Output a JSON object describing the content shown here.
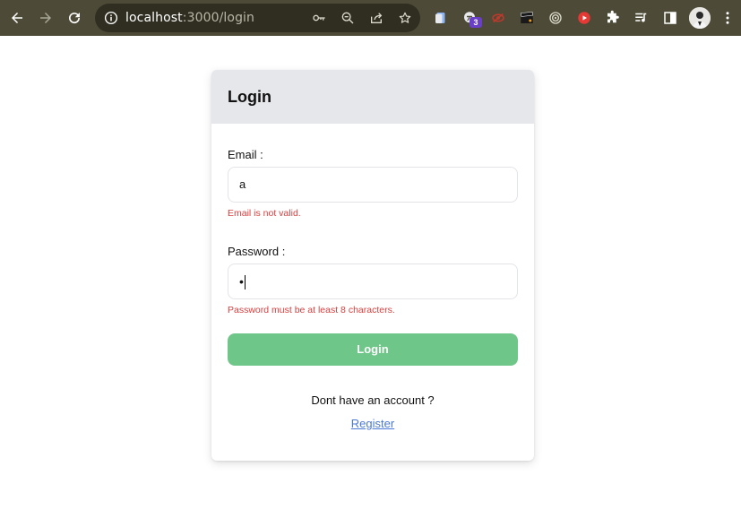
{
  "browser": {
    "url_host": "localhost",
    "url_path": ":3000/login",
    "extension_badge": "3",
    "icons": [
      "back-arrow-icon",
      "forward-arrow-icon",
      "reload-icon",
      "info-icon",
      "key-icon",
      "zoom-out-icon",
      "share-icon",
      "star-icon",
      "extensions-puzzle-icon",
      "media-queue-icon",
      "side-panel-icon",
      "kebab-menu-icon"
    ],
    "colors": {
      "chrome_bg": "#4d4a37",
      "omnibox_bg": "#302e21"
    }
  },
  "login": {
    "title": "Login",
    "email_label": "Email :",
    "email_value": "a",
    "email_error": "Email is not valid.",
    "password_label": "Password :",
    "password_value": "•",
    "password_error": "Password must be at least 8 characters.",
    "submit_label": "Login",
    "no_account_prompt": "Dont have an account ?",
    "register_link": "Register",
    "colors": {
      "header_bg": "#e6e7eb",
      "submit_bg": "#6fc689",
      "error": "#d94040",
      "link": "#4a78d6"
    }
  }
}
